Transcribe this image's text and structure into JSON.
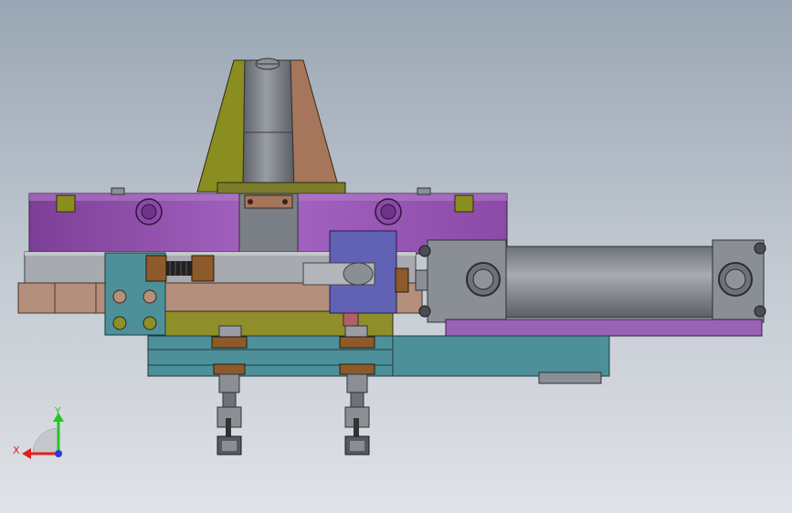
{
  "triad": {
    "x_label": "X",
    "y_label": "Y",
    "x_color": "#e0201e",
    "y_color": "#27c427",
    "z_color": "#2a3cd6"
  },
  "colors": {
    "background_top": "#9aa6b4",
    "background_bottom": "#dfe2e6",
    "cone_green": "#8a8d1f",
    "cone_brown": "#a6765c",
    "shaft_gray": "#7b7f86",
    "flange_purple": "#9a58b6",
    "gray_plate": "#9da0a5",
    "tan_plate": "#b48f7b",
    "olive_block": "#8f8f2a",
    "teal_plate": "#4d9099",
    "blue_clamp": "#6262b4",
    "cylinder_gray": "#8a8e95",
    "cylinder_rail": "#9a62b5",
    "nut_brown": "#8d5a2b"
  }
}
